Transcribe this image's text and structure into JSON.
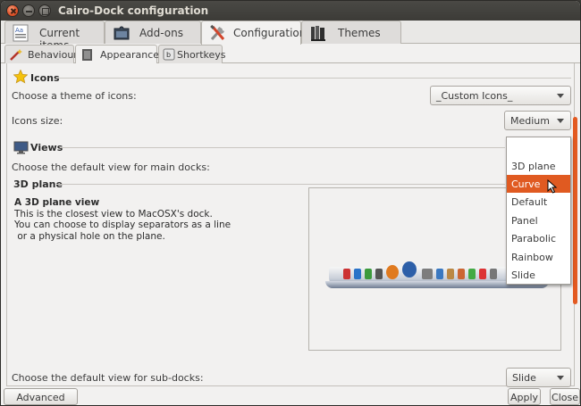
{
  "window": {
    "title": "Cairo-Dock configuration"
  },
  "main_tabs": [
    {
      "label": "Current items",
      "icon": "text-editor-icon"
    },
    {
      "label": "Add-ons",
      "icon": "jigsaw-icon"
    },
    {
      "label": "Configuration",
      "icon": "tools-icon",
      "active": true
    },
    {
      "label": "Themes",
      "icon": "books-icon"
    }
  ],
  "sub_tabs": [
    {
      "label": "Behaviour",
      "icon": "magic-wand-icon"
    },
    {
      "label": "Appearance",
      "icon": "book-icon",
      "active": true
    },
    {
      "label": "Shortkeys",
      "icon": "keyboard-key-icon"
    }
  ],
  "icons_section": {
    "title": "Icons",
    "theme_label": "Choose a theme of icons:",
    "theme_value": "_Custom Icons_",
    "size_label": "Icons size:",
    "size_value": "Medium"
  },
  "views_section": {
    "title": "Views",
    "main_docks_label": "Choose the default view for main docks:",
    "subsection_title": "3D plane",
    "description": {
      "heading": "A 3D plane view",
      "lines": [
        "This is the closest view to MacOSX's dock.",
        "You can choose to display separators as a line",
        " or a physical hole on the plane."
      ]
    },
    "sub_docks_label": "Choose the default view for sub-docks:",
    "sub_docks_value": "Slide"
  },
  "view_dropdown": {
    "options": [
      "3D plane",
      "Curve",
      "Default",
      "Panel",
      "Parabolic",
      "Rainbow",
      "Slide"
    ],
    "highlighted": "Curve"
  },
  "footer": {
    "advanced_label": "Advanced Mode",
    "apply_label": "Apply",
    "close_label": "Close"
  },
  "colors": {
    "accent": "#e05a21",
    "titlebar": "#3c3b37",
    "window_bg": "#f2f1f0"
  }
}
